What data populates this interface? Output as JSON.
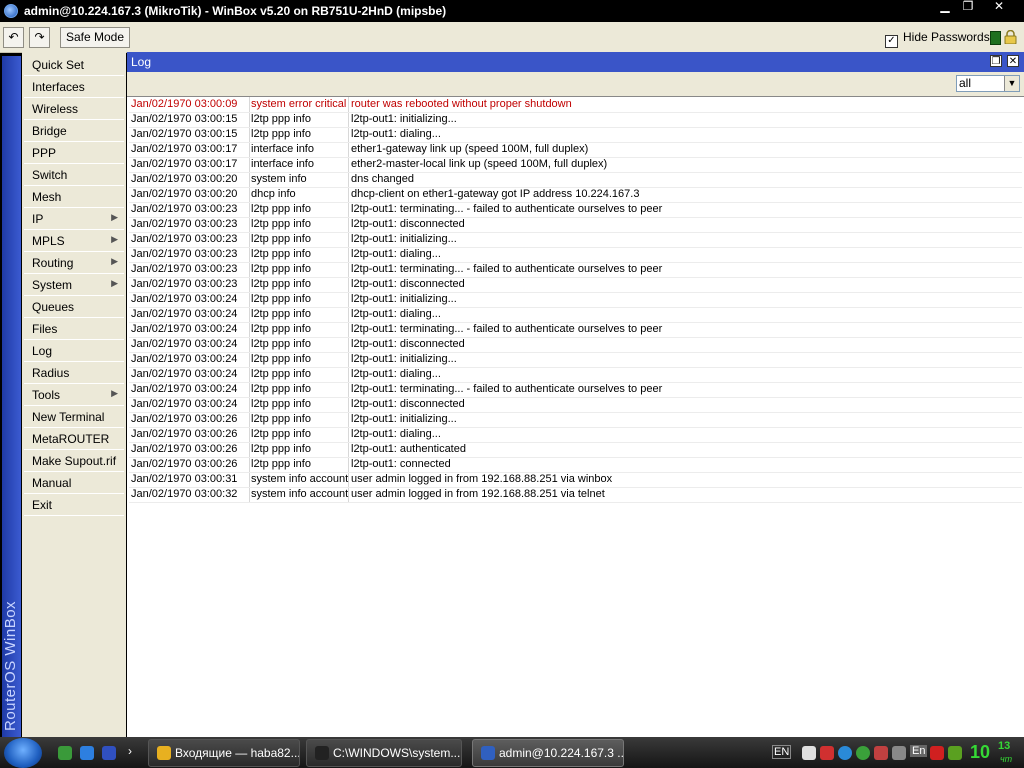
{
  "titlebar": {
    "title": "admin@10.224.167.3 (MikroTik) - WinBox v5.20 on RB751U-2HnD (mipsbe)",
    "minimize": "▁",
    "maximize": "❐",
    "close": "✕"
  },
  "toolbar": {
    "undo": "↶",
    "redo": "↷",
    "safe_mode": "Safe Mode",
    "hide_passwords_label": "Hide Passwords",
    "hide_passwords_checked": "✓"
  },
  "brand": "RouterOS WinBox",
  "menu": [
    {
      "label": "Quick Set",
      "submenu": false
    },
    {
      "label": "Interfaces",
      "submenu": false
    },
    {
      "label": "Wireless",
      "submenu": false
    },
    {
      "label": "Bridge",
      "submenu": false
    },
    {
      "label": "PPP",
      "submenu": false
    },
    {
      "label": "Switch",
      "submenu": false
    },
    {
      "label": "Mesh",
      "submenu": false
    },
    {
      "label": "IP",
      "submenu": true
    },
    {
      "label": "MPLS",
      "submenu": true
    },
    {
      "label": "Routing",
      "submenu": true
    },
    {
      "label": "System",
      "submenu": true
    },
    {
      "label": "Queues",
      "submenu": false
    },
    {
      "label": "Files",
      "submenu": false
    },
    {
      "label": "Log",
      "submenu": false
    },
    {
      "label": "Radius",
      "submenu": false
    },
    {
      "label": "Tools",
      "submenu": true
    },
    {
      "label": "New Terminal",
      "submenu": false
    },
    {
      "label": "MetaROUTER",
      "submenu": false
    },
    {
      "label": "Make Supout.rif",
      "submenu": false
    },
    {
      "label": "Manual",
      "submenu": false
    },
    {
      "label": "Exit",
      "submenu": false
    }
  ],
  "log_window": {
    "title": "Log",
    "filter_value": "all",
    "rows": [
      {
        "time": "Jan/02/1970 03:00:09",
        "topics": "system error critical",
        "message": "router was rebooted without proper shutdown",
        "error": true
      },
      {
        "time": "Jan/02/1970 03:00:15",
        "topics": "l2tp ppp info",
        "message": "l2tp-out1: initializing...",
        "error": false
      },
      {
        "time": "Jan/02/1970 03:00:15",
        "topics": "l2tp ppp info",
        "message": "l2tp-out1: dialing...",
        "error": false
      },
      {
        "time": "Jan/02/1970 03:00:17",
        "topics": "interface info",
        "message": "ether1-gateway link up (speed 100M, full duplex)",
        "error": false
      },
      {
        "time": "Jan/02/1970 03:00:17",
        "topics": "interface info",
        "message": "ether2-master-local link up (speed 100M, full duplex)",
        "error": false
      },
      {
        "time": "Jan/02/1970 03:00:20",
        "topics": "system info",
        "message": "dns changed",
        "error": false
      },
      {
        "time": "Jan/02/1970 03:00:20",
        "topics": "dhcp info",
        "message": "dhcp-client on ether1-gateway got IP address 10.224.167.3",
        "error": false
      },
      {
        "time": "Jan/02/1970 03:00:23",
        "topics": "l2tp ppp info",
        "message": "l2tp-out1: terminating... - failed to authenticate ourselves to peer",
        "error": false
      },
      {
        "time": "Jan/02/1970 03:00:23",
        "topics": "l2tp ppp info",
        "message": "l2tp-out1: disconnected",
        "error": false
      },
      {
        "time": "Jan/02/1970 03:00:23",
        "topics": "l2tp ppp info",
        "message": "l2tp-out1: initializing...",
        "error": false
      },
      {
        "time": "Jan/02/1970 03:00:23",
        "topics": "l2tp ppp info",
        "message": "l2tp-out1: dialing...",
        "error": false
      },
      {
        "time": "Jan/02/1970 03:00:23",
        "topics": "l2tp ppp info",
        "message": "l2tp-out1: terminating... - failed to authenticate ourselves to peer",
        "error": false
      },
      {
        "time": "Jan/02/1970 03:00:23",
        "topics": "l2tp ppp info",
        "message": "l2tp-out1: disconnected",
        "error": false
      },
      {
        "time": "Jan/02/1970 03:00:24",
        "topics": "l2tp ppp info",
        "message": "l2tp-out1: initializing...",
        "error": false
      },
      {
        "time": "Jan/02/1970 03:00:24",
        "topics": "l2tp ppp info",
        "message": "l2tp-out1: dialing...",
        "error": false
      },
      {
        "time": "Jan/02/1970 03:00:24",
        "topics": "l2tp ppp info",
        "message": "l2tp-out1: terminating... - failed to authenticate ourselves to peer",
        "error": false
      },
      {
        "time": "Jan/02/1970 03:00:24",
        "topics": "l2tp ppp info",
        "message": "l2tp-out1: disconnected",
        "error": false
      },
      {
        "time": "Jan/02/1970 03:00:24",
        "topics": "l2tp ppp info",
        "message": "l2tp-out1: initializing...",
        "error": false
      },
      {
        "time": "Jan/02/1970 03:00:24",
        "topics": "l2tp ppp info",
        "message": "l2tp-out1: dialing...",
        "error": false
      },
      {
        "time": "Jan/02/1970 03:00:24",
        "topics": "l2tp ppp info",
        "message": "l2tp-out1: terminating... - failed to authenticate ourselves to peer",
        "error": false
      },
      {
        "time": "Jan/02/1970 03:00:24",
        "topics": "l2tp ppp info",
        "message": "l2tp-out1: disconnected",
        "error": false
      },
      {
        "time": "Jan/02/1970 03:00:26",
        "topics": "l2tp ppp info",
        "message": "l2tp-out1: initializing...",
        "error": false
      },
      {
        "time": "Jan/02/1970 03:00:26",
        "topics": "l2tp ppp info",
        "message": "l2tp-out1: dialing...",
        "error": false
      },
      {
        "time": "Jan/02/1970 03:00:26",
        "topics": "l2tp ppp info",
        "message": "l2tp-out1: authenticated",
        "error": false
      },
      {
        "time": "Jan/02/1970 03:00:26",
        "topics": "l2tp ppp info",
        "message": "l2tp-out1: connected",
        "error": false
      },
      {
        "time": "Jan/02/1970 03:00:31",
        "topics": "system info account",
        "message": "user admin logged in from 192.168.88.251 via winbox",
        "error": false
      },
      {
        "time": "Jan/02/1970 03:00:32",
        "topics": "system info account",
        "message": "user admin logged in from 192.168.88.251 via telnet",
        "error": false
      }
    ]
  },
  "taskbar": {
    "tasks": [
      {
        "label": "Входящие — haba82...",
        "icon": "chrome-icon",
        "active": false
      },
      {
        "label": "C:\\WINDOWS\\system...",
        "icon": "cmd-icon",
        "active": false
      },
      {
        "label": "admin@10.224.167.3 ...",
        "icon": "winbox-icon",
        "active": true
      }
    ],
    "lang": "EN",
    "lang2": "En",
    "clock_hour": "10",
    "clock_min": "13",
    "clock_day": "чт"
  },
  "colors": {
    "error_text": "#c00000",
    "window_title_bg": "#3a55c8",
    "clock": "#35d935"
  }
}
